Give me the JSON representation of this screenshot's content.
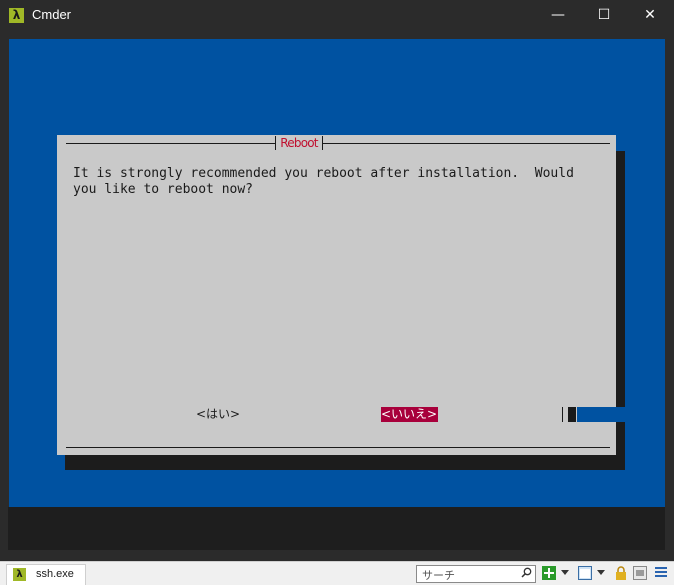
{
  "window": {
    "title": "Cmder",
    "app_icon_glyph": "λ",
    "controls": {
      "minimize": "—",
      "maximize": "☐",
      "close": "✕"
    }
  },
  "dialog": {
    "title": "Reboot",
    "message": "It is strongly recommended you reboot after installation.  Would\nyou like to reboot now?",
    "yes_button": "<はい>",
    "no_button": "<いいえ>",
    "selected_button": "no"
  },
  "statusbar": {
    "tab_label": "ssh.exe",
    "tab_icon_glyph": "λ",
    "search_placeholder": "サーチ",
    "icons": [
      "search-icon",
      "new-console-icon",
      "dropdown-icon",
      "split-icon",
      "dropdown-icon",
      "lock-icon",
      "settings-icon",
      "menu-icon"
    ]
  },
  "colors": {
    "console_bg": "#0052a1",
    "dialog_bg": "#c9c9c9",
    "title_red": "#c0102f",
    "selected_bg": "#a8003b",
    "accent_green": "#a0b827"
  }
}
